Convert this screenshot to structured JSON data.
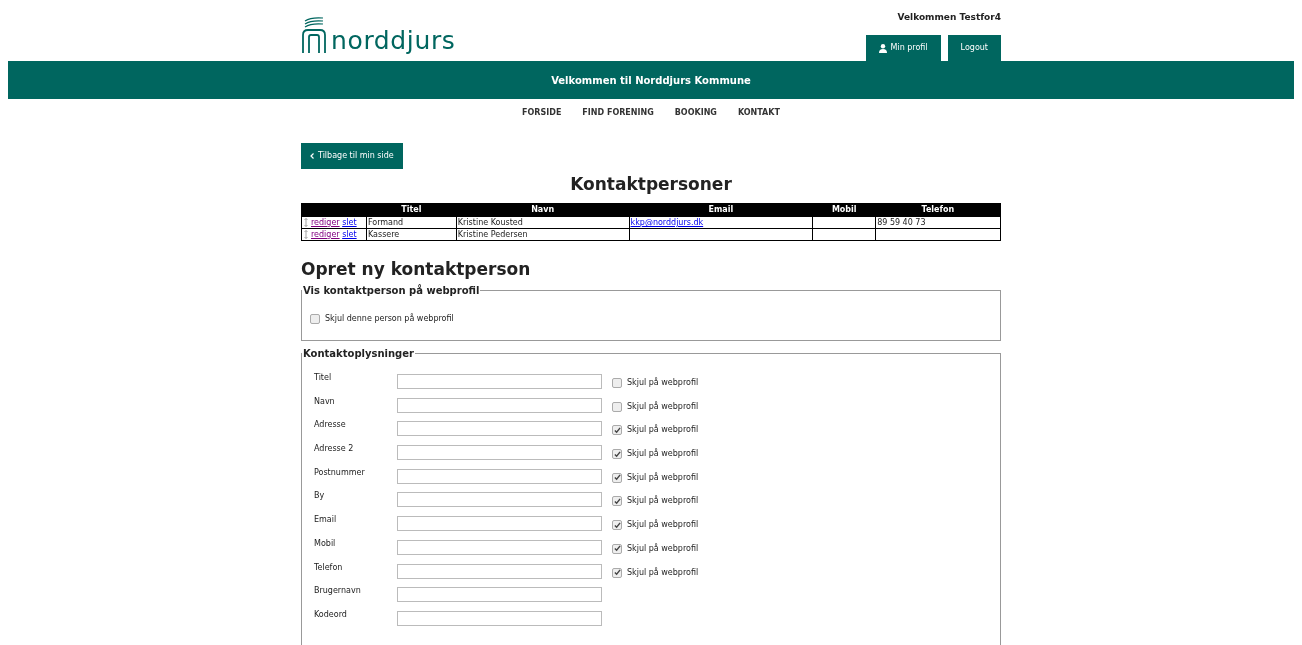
{
  "header": {
    "logo_text": "norddjurs",
    "welcome": "Velkommen Testfor4",
    "buttons": [
      {
        "kind": "profile",
        "label": "Min profil"
      },
      {
        "kind": "plain",
        "label": "Logout"
      }
    ]
  },
  "banner": "Velkommen til Norddjurs Kommune",
  "nav": [
    "FORSIDE",
    "FIND FORENING",
    "BOOKING",
    "KONTAKT"
  ],
  "back_button": "Tilbage til min side",
  "contacts": {
    "title": "Kontaktpersoner",
    "columns": [
      "Titel",
      "Navn",
      "Email",
      "Mobil",
      "Telefon"
    ],
    "rows": [
      {
        "edit": "rediger",
        "delete": "slet",
        "cells": [
          "Formand",
          "Kristine Kousted",
          "kkp@norddjurs.dk",
          "",
          "89 59 40 73"
        ]
      },
      {
        "edit": "rediger",
        "delete": "slet",
        "cells": [
          "Kassere",
          "Kristine Pedersen",
          "",
          "",
          ""
        ]
      }
    ]
  },
  "form_title": "Opret ny kontaktperson",
  "visibility": {
    "legend": "Vis kontaktperson på webprofil",
    "checkbox": {
      "label": "Skjul denne person på webprofil",
      "checked": false
    }
  },
  "contact_info": {
    "legend": "Kontaktoplysninger",
    "fields": [
      {
        "label": "Titel",
        "hide": {
          "label": "Skjul på webprofil",
          "checked": false
        }
      },
      {
        "label": "Navn",
        "hide": {
          "label": "Skjul på webprofil",
          "checked": false
        }
      },
      {
        "label": "Adresse",
        "hide": {
          "label": "Skjul på webprofil",
          "checked": true
        }
      },
      {
        "label": "Adresse 2",
        "hide": {
          "label": "Skjul på webprofil",
          "checked": true
        }
      },
      {
        "label": "Postnummer",
        "hide": {
          "label": "Skjul på webprofil",
          "checked": true
        }
      },
      {
        "label": "By",
        "hide": {
          "label": "Skjul på webprofil",
          "checked": true
        }
      },
      {
        "label": "Email",
        "hide": {
          "label": "Skjul på webprofil",
          "checked": true
        }
      },
      {
        "label": "Mobil",
        "hide": {
          "label": "Skjul på webprofil",
          "checked": true
        }
      },
      {
        "label": "Telefon",
        "hide": {
          "label": "Skjul på webprofil",
          "checked": true
        }
      },
      {
        "label": "Brugernavn"
      },
      {
        "label": "Kodeord"
      }
    ]
  }
}
